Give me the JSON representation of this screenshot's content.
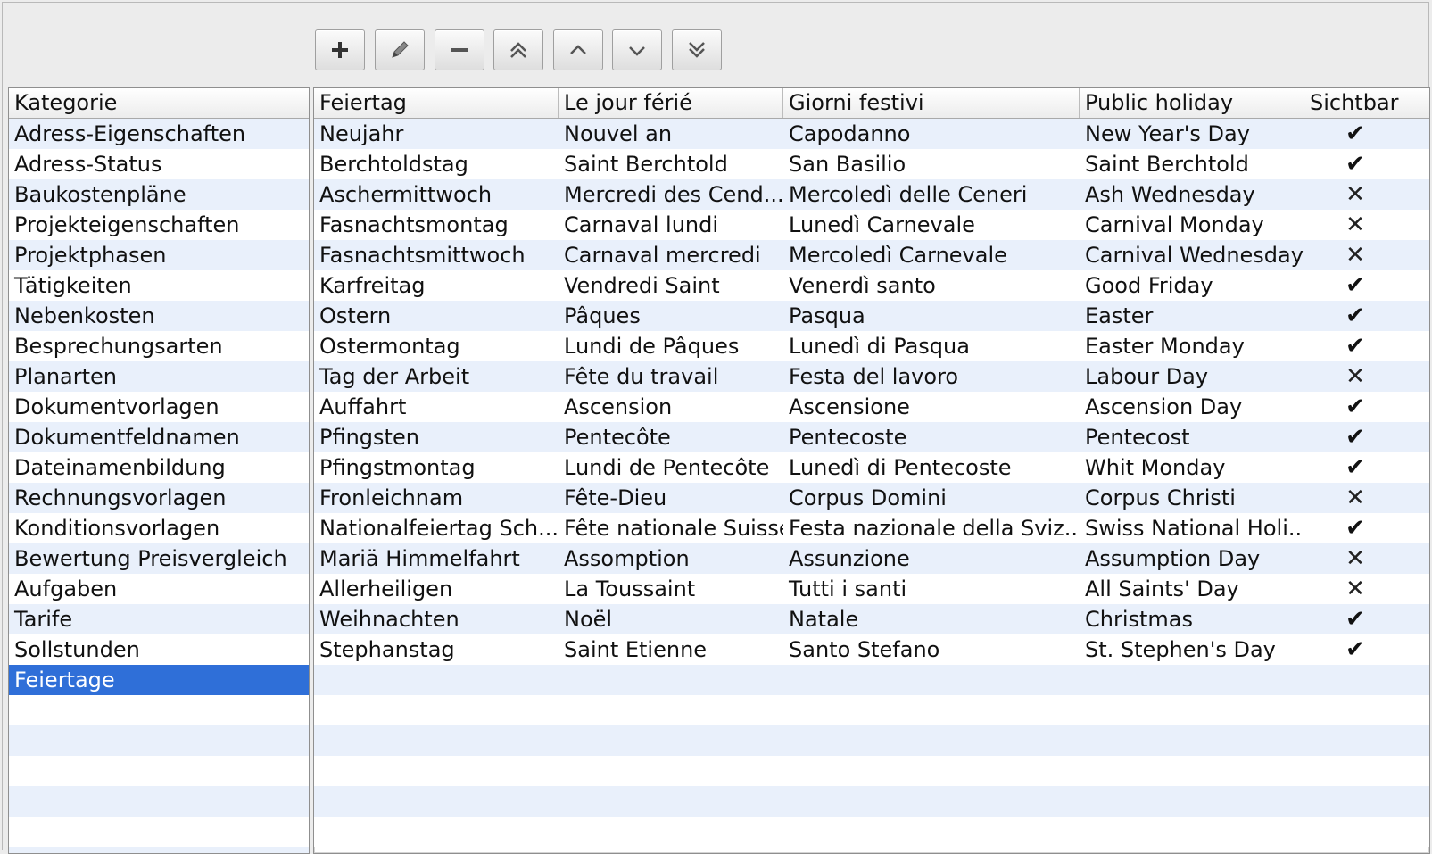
{
  "toolbar": {
    "buttons": [
      {
        "name": "add-button",
        "icon": "plus-icon"
      },
      {
        "name": "edit-button",
        "icon": "pencil-icon"
      },
      {
        "name": "remove-button",
        "icon": "minus-icon"
      },
      {
        "name": "move-top-button",
        "icon": "double-chevron-up-icon"
      },
      {
        "name": "move-up-button",
        "icon": "chevron-up-icon"
      },
      {
        "name": "move-down-button",
        "icon": "chevron-down-icon"
      },
      {
        "name": "move-bottom-button",
        "icon": "double-chevron-down-icon"
      }
    ]
  },
  "categories": {
    "header": "Kategorie",
    "items": [
      "Adress-Eigenschaften",
      "Adress-Status",
      "Baukostenpläne",
      "Projekteigenschaften",
      "Projektphasen",
      "Tätigkeiten",
      "Nebenkosten",
      "Besprechungsarten",
      "Planarten",
      "Dokumentvorlagen",
      "Dokumentfeldnamen",
      "Dateinamenbildung",
      "Rechnungsvorlagen",
      "Konditionsvorlagen",
      "Bewertung Preisvergleich",
      "Aufgaben",
      "Tarife",
      "Sollstunden",
      "Feiertage"
    ],
    "selected_index": 18
  },
  "holidays": {
    "headers": [
      "Feiertag",
      "Le jour férié",
      "Giorni festivi",
      "Public holiday",
      "Sichtbar"
    ],
    "rows": [
      {
        "de": "Neujahr",
        "fr": "Nouvel an",
        "it": "Capodanno",
        "en": "New Year's Day",
        "visible": true
      },
      {
        "de": "Berchtoldstag",
        "fr": "Saint Berchtold",
        "it": "San Basilio",
        "en": "Saint Berchtold",
        "visible": true
      },
      {
        "de": "Aschermittwoch",
        "fr": "Mercredi des Cend...",
        "it": "Mercoledì delle Ceneri",
        "en": "Ash Wednesday",
        "visible": false
      },
      {
        "de": "Fasnachtsmontag",
        "fr": "Carnaval lundi",
        "it": "Lunedì Carnevale",
        "en": "Carnival Monday",
        "visible": false
      },
      {
        "de": "Fasnachtsmittwoch",
        "fr": "Carnaval mercredi",
        "it": "Mercoledì Carnevale",
        "en": "Carnival Wednesday",
        "visible": false
      },
      {
        "de": "Karfreitag",
        "fr": "Vendredi Saint",
        "it": "Venerdì santo",
        "en": "Good Friday",
        "visible": true
      },
      {
        "de": "Ostern",
        "fr": "Pâques",
        "it": "Pasqua",
        "en": "Easter",
        "visible": true
      },
      {
        "de": "Ostermontag",
        "fr": "Lundi de Pâques",
        "it": "Lunedì di Pasqua",
        "en": "Easter Monday",
        "visible": true
      },
      {
        "de": "Tag der Arbeit",
        "fr": "Fête du travail",
        "it": "Festa del lavoro",
        "en": "Labour Day",
        "visible": false
      },
      {
        "de": "Auffahrt",
        "fr": "Ascension",
        "it": "Ascensione",
        "en": "Ascension Day",
        "visible": true
      },
      {
        "de": "Pfingsten",
        "fr": "Pentecôte",
        "it": "Pentecoste",
        "en": "Pentecost",
        "visible": true
      },
      {
        "de": "Pfingstmontag",
        "fr": "Lundi de Pentecôte",
        "it": "Lunedì di Pentecoste",
        "en": "Whit Monday",
        "visible": true
      },
      {
        "de": "Fronleichnam",
        "fr": "Fête-Dieu",
        "it": "Corpus Domini",
        "en": "Corpus Christi",
        "visible": false
      },
      {
        "de": "Nationalfeiertag Sch...",
        "fr": "Fête nationale Suisse",
        "it": "Festa nazionale della Sviz...",
        "en": "Swiss National Holi...",
        "visible": true
      },
      {
        "de": "Mariä Himmelfahrt",
        "fr": "Assomption",
        "it": "Assunzione",
        "en": "Assumption Day",
        "visible": false
      },
      {
        "de": "Allerheiligen",
        "fr": "La Toussaint",
        "it": "Tutti i santi",
        "en": "All Saints' Day",
        "visible": false
      },
      {
        "de": "Weihnachten",
        "fr": "Noël",
        "it": "Natale",
        "en": "Christmas",
        "visible": true
      },
      {
        "de": "Stephanstag",
        "fr": "Saint Etienne",
        "it": "Santo Stefano",
        "en": "St. Stephen's Day",
        "visible": true
      }
    ],
    "check_glyph": "✔",
    "cross_glyph": "✕"
  }
}
